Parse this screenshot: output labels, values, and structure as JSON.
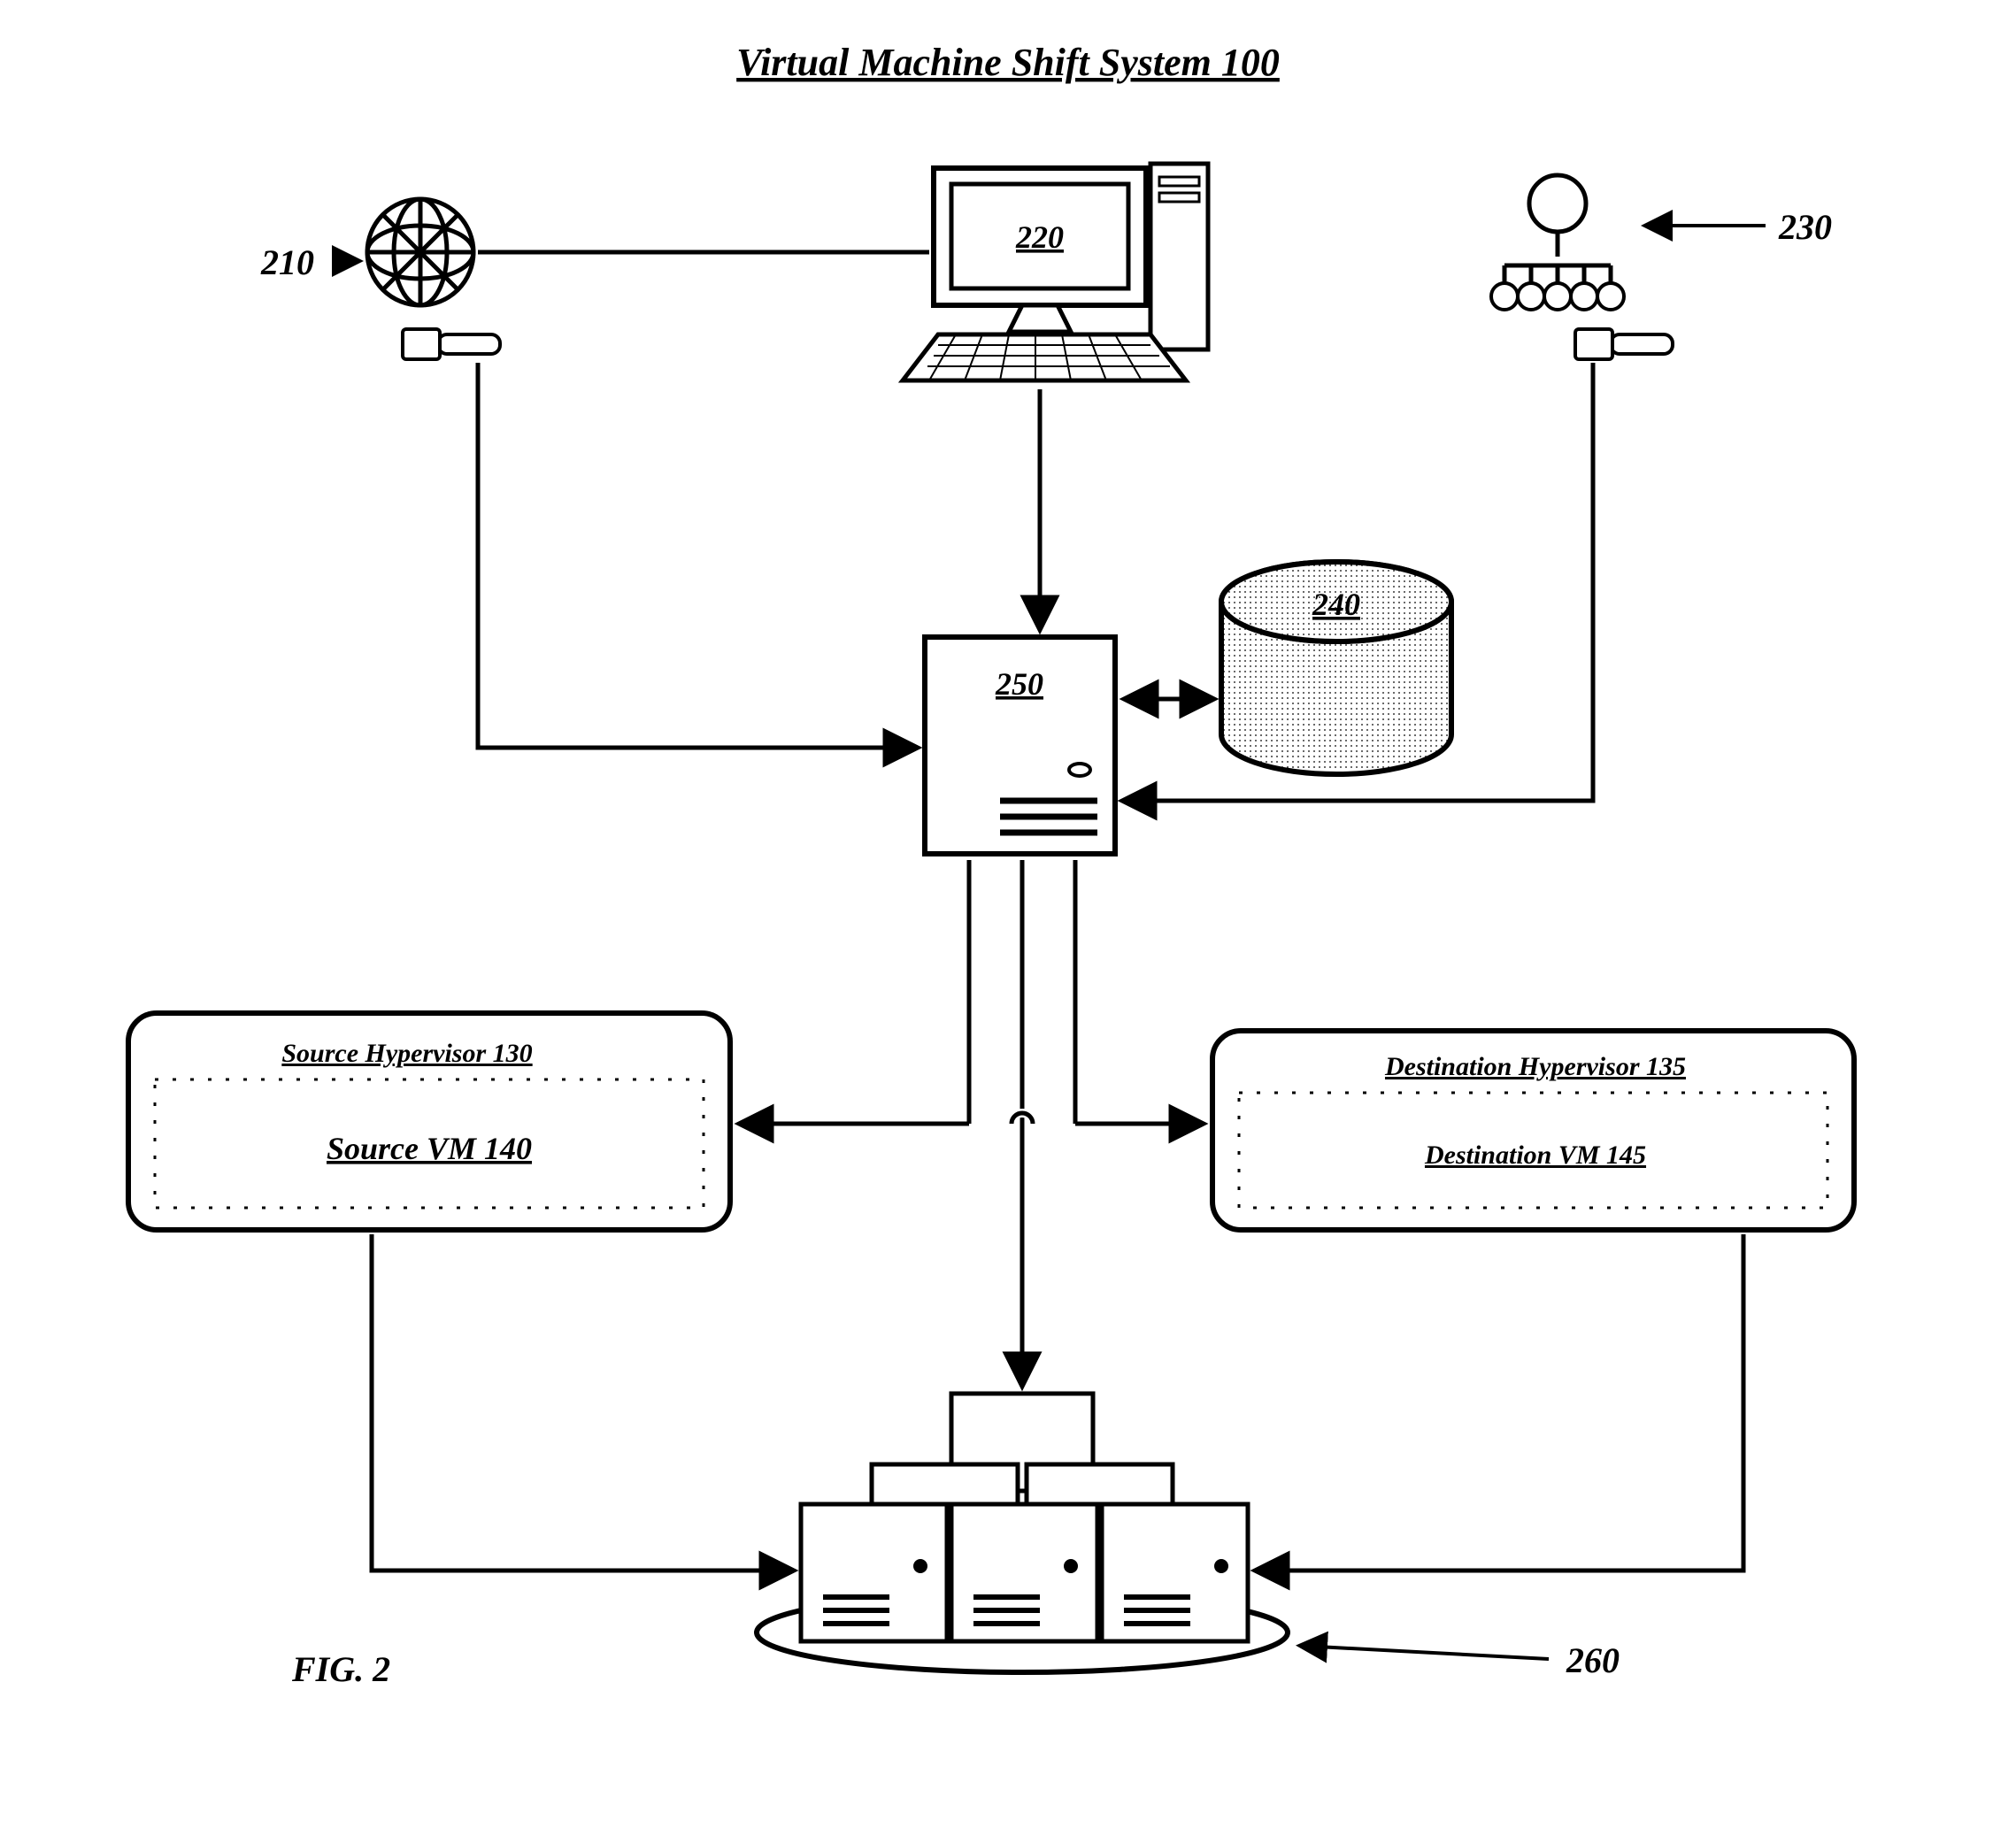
{
  "title": "Virtual Machine Shift System 100",
  "figure_label": "FIG. 2",
  "refs": {
    "r210": "210",
    "r220": "220",
    "r230": "230",
    "r240": "240",
    "r250": "250",
    "r260": "260"
  },
  "source_hypervisor_label": "Source Hypervisor 130",
  "source_vm_label": "Source VM 140",
  "dest_hypervisor_label": "Destination Hypervisor 135",
  "dest_vm_label": "Destination VM 145"
}
